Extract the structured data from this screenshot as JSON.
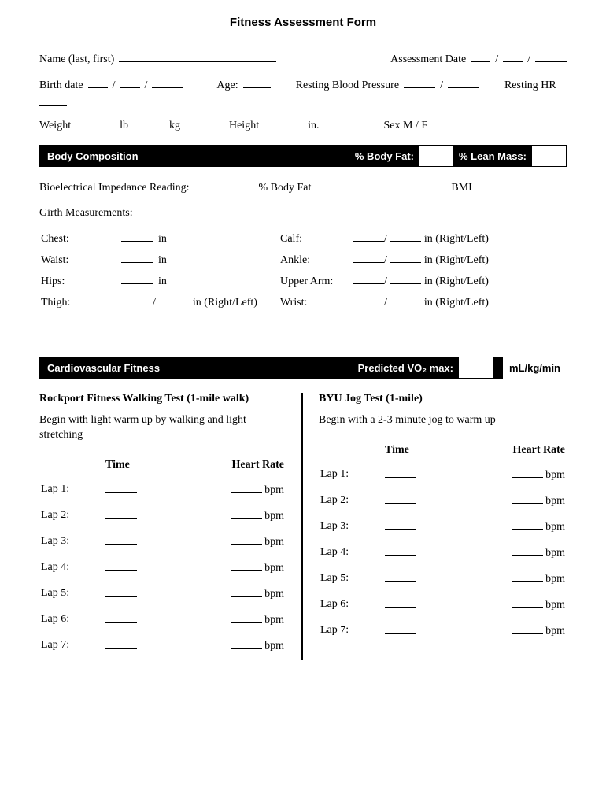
{
  "title": "Fitness Assessment Form",
  "fields": {
    "name_label": "Name (last, first)",
    "assessment_date_label": "Assessment Date",
    "birth_date_label": "Birth date",
    "age_label": "Age:",
    "resting_bp_label": "Resting Blood Pressure",
    "resting_hr_label": "Resting HR",
    "weight_label": "Weight",
    "weight_lb": "lb",
    "weight_kg": "kg",
    "height_label": "Height",
    "height_in": "in.",
    "sex_label": "Sex  M / F"
  },
  "body_comp": {
    "header": "Body Composition",
    "body_fat_label": "% Body Fat:",
    "lean_mass_label": "% Lean Mass:",
    "bioelectrical": "Bioelectrical Impedance Reading:",
    "pct_body_fat": "% Body Fat",
    "bmi": "BMI",
    "girth_header": "Girth Measurements:",
    "chest": "Chest:",
    "waist": "Waist:",
    "hips": "Hips:",
    "thigh": "Thigh:",
    "calf": "Calf:",
    "ankle": "Ankle:",
    "upper_arm": "Upper Arm:",
    "wrist": "Wrist:",
    "in": "in",
    "in_rl": "in (Right/Left)"
  },
  "cardio": {
    "header": "Cardiovascular Fitness",
    "vo2_label": "Predicted VO₂ max:",
    "vo2_unit": "mL/kg/min",
    "rockport": {
      "title": "Rockport Fitness Walking Test (1-mile walk)",
      "sub": "Begin with light warm up by walking and light stretching"
    },
    "byu": {
      "title": "BYU Jog Test (1-mile)",
      "sub": "Begin with a 2-3 minute jog to warm up"
    },
    "time_h": "Time",
    "hr_h": "Heart Rate",
    "bpm": "bpm",
    "laps": [
      "Lap 1:",
      "Lap 2:",
      "Lap 3:",
      "Lap 4:",
      "Lap 5:",
      "Lap 6:",
      "Lap 7:"
    ]
  }
}
